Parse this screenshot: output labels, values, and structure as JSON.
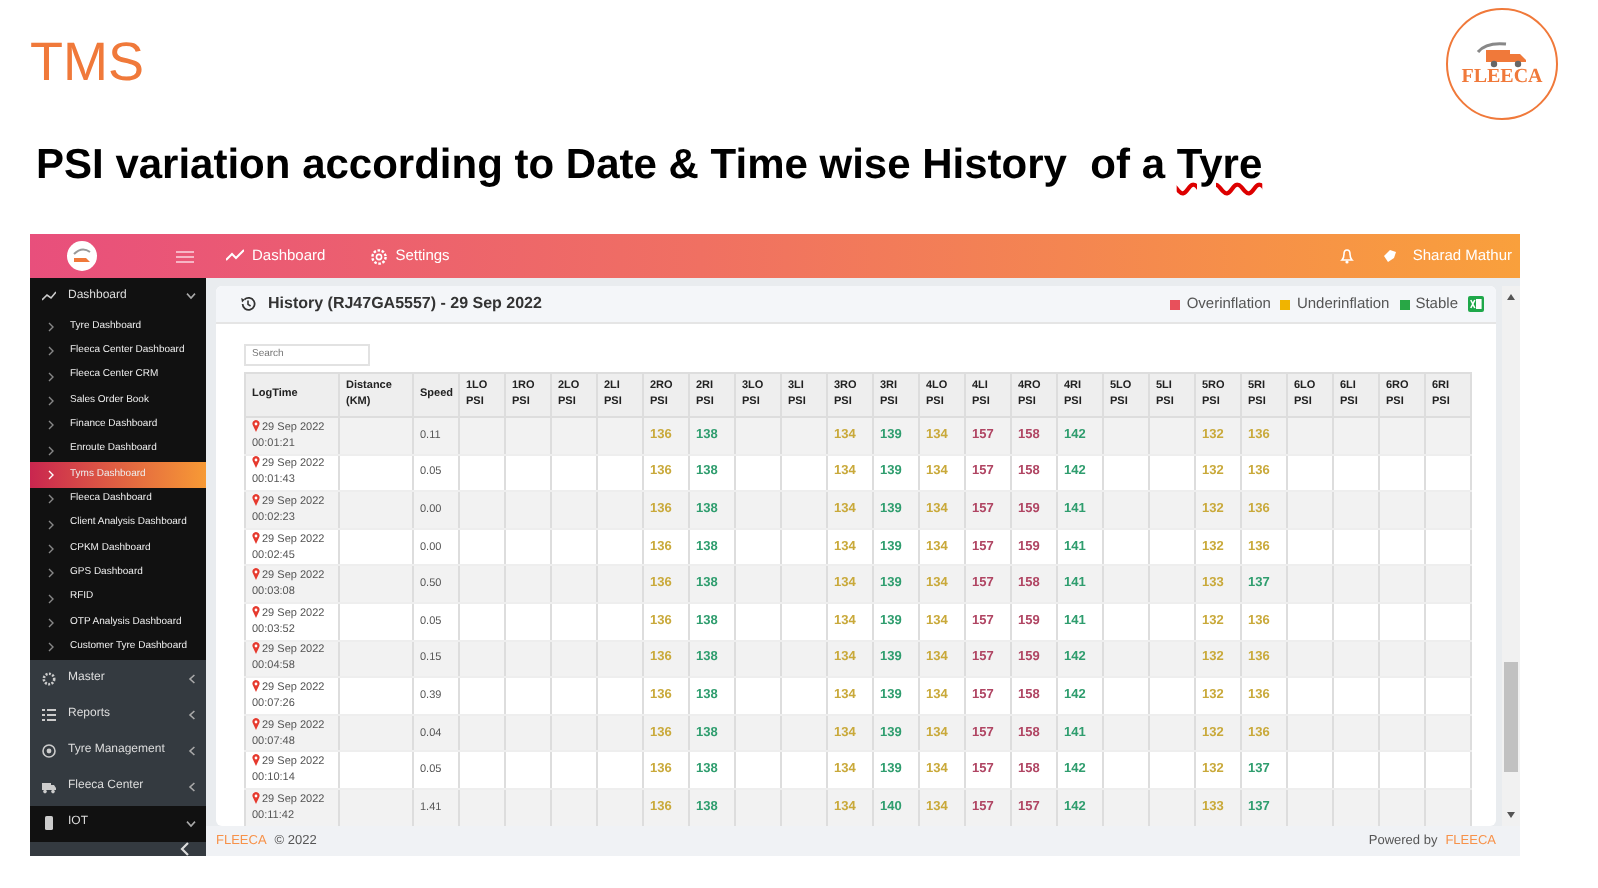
{
  "slide": {
    "title": "TMS",
    "heading": "PSI variation according to Date & Time wise History  of a Tyre",
    "logo_text": "FLEECA"
  },
  "topbar": {
    "nav": [
      {
        "label": "Dashboard"
      },
      {
        "label": "Settings"
      }
    ],
    "user": "Sharad Mathur"
  },
  "sidebar": {
    "items": [
      {
        "label": "Dashboard",
        "expanded": true,
        "children": [
          {
            "label": "Tyre Dashboard",
            "selected": false
          },
          {
            "label": "Fleeca Center Dashboard",
            "selected": false
          },
          {
            "label": "Fleeca Center CRM",
            "selected": false
          },
          {
            "label": "Sales Order Book",
            "selected": false
          },
          {
            "label": "Finance Dashboard",
            "selected": false
          },
          {
            "label": "Enroute Dashboard",
            "selected": false
          },
          {
            "label": "Tyms Dashboard",
            "selected": true
          },
          {
            "label": "Fleeca Dashboard",
            "selected": false
          },
          {
            "label": "Client Analysis Dashboard",
            "selected": false
          },
          {
            "label": "CPKM Dashboard",
            "selected": false
          },
          {
            "label": "GPS Dashboard",
            "selected": false
          },
          {
            "label": "RFID",
            "selected": false
          },
          {
            "label": "OTP Analysis Dashboard",
            "selected": false
          },
          {
            "label": "Customer Tyre Dashboard",
            "selected": false
          }
        ]
      },
      {
        "label": "Master",
        "expanded": false
      },
      {
        "label": "Reports",
        "expanded": false
      },
      {
        "label": "Tyre Management",
        "expanded": false
      },
      {
        "label": "Fleeca Center",
        "expanded": false
      },
      {
        "label": "IOT",
        "expanded": true
      }
    ]
  },
  "card": {
    "title": "History (RJ47GA5557) - 29 Sep 2022",
    "legend": [
      {
        "label": "Overinflation",
        "color": "#e8505b"
      },
      {
        "label": "Underinflation",
        "color": "#f0b400"
      },
      {
        "label": "Stable",
        "color": "#28a745"
      }
    ],
    "search": {
      "placeholder": "Search"
    },
    "table": {
      "columns": [
        "LogTime",
        "Distance (KM)",
        "Speed",
        "1LO PSI",
        "1RO PSI",
        "2LO PSI",
        "2LI PSI",
        "2RO PSI",
        "2RI PSI",
        "3LO PSI",
        "3LI PSI",
        "3RO PSI",
        "3RI PSI",
        "4LO PSI",
        "4LI PSI",
        "4RO PSI",
        "4RI PSI",
        "5LO PSI",
        "5LI PSI",
        "5RO PSI",
        "5RI PSI",
        "6LO PSI",
        "6LI PSI",
        "6RO PSI",
        "6RI PSI"
      ],
      "rows": [
        {
          "date": "29 Sep 2022",
          "time": "00:01:21",
          "speed": "0.11",
          "psi": {
            "2RO": {
              "value": "136",
              "color": "#c9a93a"
            },
            "2RI": {
              "value": "138",
              "color": "#2f9d6e"
            },
            "3RO": {
              "value": "134",
              "color": "#c9a93a"
            },
            "3RI": {
              "value": "139",
              "color": "#2f9d6e"
            },
            "4LO": {
              "value": "134",
              "color": "#c9a93a"
            },
            "4LI": {
              "value": "157",
              "color": "#b04563"
            },
            "4RO": {
              "value": "158",
              "color": "#b04563"
            },
            "4RI": {
              "value": "142",
              "color": "#2f9d6e"
            },
            "5RO": {
              "value": "132",
              "color": "#c9a93a"
            },
            "5RI": {
              "value": "136",
              "color": "#c9a93a"
            }
          }
        },
        {
          "date": "29 Sep 2022",
          "time": "00:01:43",
          "speed": "0.05",
          "psi": {
            "2RO": {
              "value": "136",
              "color": "#c9a93a"
            },
            "2RI": {
              "value": "138",
              "color": "#2f9d6e"
            },
            "3RO": {
              "value": "134",
              "color": "#c9a93a"
            },
            "3RI": {
              "value": "139",
              "color": "#2f9d6e"
            },
            "4LO": {
              "value": "134",
              "color": "#c9a93a"
            },
            "4LI": {
              "value": "157",
              "color": "#b04563"
            },
            "4RO": {
              "value": "158",
              "color": "#b04563"
            },
            "4RI": {
              "value": "142",
              "color": "#2f9d6e"
            },
            "5RO": {
              "value": "132",
              "color": "#c9a93a"
            },
            "5RI": {
              "value": "136",
              "color": "#c9a93a"
            }
          }
        },
        {
          "date": "29 Sep 2022",
          "time": "00:02:23",
          "speed": "0.00",
          "psi": {
            "2RO": {
              "value": "136",
              "color": "#c9a93a"
            },
            "2RI": {
              "value": "138",
              "color": "#2f9d6e"
            },
            "3RO": {
              "value": "134",
              "color": "#c9a93a"
            },
            "3RI": {
              "value": "139",
              "color": "#2f9d6e"
            },
            "4LO": {
              "value": "134",
              "color": "#c9a93a"
            },
            "4LI": {
              "value": "157",
              "color": "#b04563"
            },
            "4RO": {
              "value": "159",
              "color": "#b04563"
            },
            "4RI": {
              "value": "141",
              "color": "#2f9d6e"
            },
            "5RO": {
              "value": "132",
              "color": "#c9a93a"
            },
            "5RI": {
              "value": "136",
              "color": "#c9a93a"
            }
          }
        },
        {
          "date": "29 Sep 2022",
          "time": "00:02:45",
          "speed": "0.00",
          "psi": {
            "2RO": {
              "value": "136",
              "color": "#c9a93a"
            },
            "2RI": {
              "value": "138",
              "color": "#2f9d6e"
            },
            "3RO": {
              "value": "134",
              "color": "#c9a93a"
            },
            "3RI": {
              "value": "139",
              "color": "#2f9d6e"
            },
            "4LO": {
              "value": "134",
              "color": "#c9a93a"
            },
            "4LI": {
              "value": "157",
              "color": "#b04563"
            },
            "4RO": {
              "value": "159",
              "color": "#b04563"
            },
            "4RI": {
              "value": "141",
              "color": "#2f9d6e"
            },
            "5RO": {
              "value": "132",
              "color": "#c9a93a"
            },
            "5RI": {
              "value": "136",
              "color": "#c9a93a"
            }
          }
        },
        {
          "date": "29 Sep 2022",
          "time": "00:03:08",
          "speed": "0.50",
          "psi": {
            "2RO": {
              "value": "136",
              "color": "#c9a93a"
            },
            "2RI": {
              "value": "138",
              "color": "#2f9d6e"
            },
            "3RO": {
              "value": "134",
              "color": "#c9a93a"
            },
            "3RI": {
              "value": "139",
              "color": "#2f9d6e"
            },
            "4LO": {
              "value": "134",
              "color": "#c9a93a"
            },
            "4LI": {
              "value": "157",
              "color": "#b04563"
            },
            "4RO": {
              "value": "158",
              "color": "#b04563"
            },
            "4RI": {
              "value": "141",
              "color": "#2f9d6e"
            },
            "5RO": {
              "value": "133",
              "color": "#c9a93a"
            },
            "5RI": {
              "value": "137",
              "color": "#2f9d6e"
            }
          }
        },
        {
          "date": "29 Sep 2022",
          "time": "00:03:52",
          "speed": "0.05",
          "psi": {
            "2RO": {
              "value": "136",
              "color": "#c9a93a"
            },
            "2RI": {
              "value": "138",
              "color": "#2f9d6e"
            },
            "3RO": {
              "value": "134",
              "color": "#c9a93a"
            },
            "3RI": {
              "value": "139",
              "color": "#2f9d6e"
            },
            "4LO": {
              "value": "134",
              "color": "#c9a93a"
            },
            "4LI": {
              "value": "157",
              "color": "#b04563"
            },
            "4RO": {
              "value": "159",
              "color": "#b04563"
            },
            "4RI": {
              "value": "141",
              "color": "#2f9d6e"
            },
            "5RO": {
              "value": "132",
              "color": "#c9a93a"
            },
            "5RI": {
              "value": "136",
              "color": "#c9a93a"
            }
          }
        },
        {
          "date": "29 Sep 2022",
          "time": "00:04:58",
          "speed": "0.15",
          "psi": {
            "2RO": {
              "value": "136",
              "color": "#c9a93a"
            },
            "2RI": {
              "value": "138",
              "color": "#2f9d6e"
            },
            "3RO": {
              "value": "134",
              "color": "#c9a93a"
            },
            "3RI": {
              "value": "139",
              "color": "#2f9d6e"
            },
            "4LO": {
              "value": "134",
              "color": "#c9a93a"
            },
            "4LI": {
              "value": "157",
              "color": "#b04563"
            },
            "4RO": {
              "value": "159",
              "color": "#b04563"
            },
            "4RI": {
              "value": "142",
              "color": "#2f9d6e"
            },
            "5RO": {
              "value": "132",
              "color": "#c9a93a"
            },
            "5RI": {
              "value": "136",
              "color": "#c9a93a"
            }
          }
        },
        {
          "date": "29 Sep 2022",
          "time": "00:07:26",
          "speed": "0.39",
          "psi": {
            "2RO": {
              "value": "136",
              "color": "#c9a93a"
            },
            "2RI": {
              "value": "138",
              "color": "#2f9d6e"
            },
            "3RO": {
              "value": "134",
              "color": "#c9a93a"
            },
            "3RI": {
              "value": "139",
              "color": "#2f9d6e"
            },
            "4LO": {
              "value": "134",
              "color": "#c9a93a"
            },
            "4LI": {
              "value": "157",
              "color": "#b04563"
            },
            "4RO": {
              "value": "158",
              "color": "#b04563"
            },
            "4RI": {
              "value": "142",
              "color": "#2f9d6e"
            },
            "5RO": {
              "value": "132",
              "color": "#c9a93a"
            },
            "5RI": {
              "value": "136",
              "color": "#c9a93a"
            }
          }
        },
        {
          "date": "29 Sep 2022",
          "time": "00:07:48",
          "speed": "0.04",
          "psi": {
            "2RO": {
              "value": "136",
              "color": "#c9a93a"
            },
            "2RI": {
              "value": "138",
              "color": "#2f9d6e"
            },
            "3RO": {
              "value": "134",
              "color": "#c9a93a"
            },
            "3RI": {
              "value": "139",
              "color": "#2f9d6e"
            },
            "4LO": {
              "value": "134",
              "color": "#c9a93a"
            },
            "4LI": {
              "value": "157",
              "color": "#b04563"
            },
            "4RO": {
              "value": "158",
              "color": "#b04563"
            },
            "4RI": {
              "value": "141",
              "color": "#2f9d6e"
            },
            "5RO": {
              "value": "132",
              "color": "#c9a93a"
            },
            "5RI": {
              "value": "136",
              "color": "#c9a93a"
            }
          }
        },
        {
          "date": "29 Sep 2022",
          "time": "00:10:14",
          "speed": "0.05",
          "psi": {
            "2RO": {
              "value": "136",
              "color": "#c9a93a"
            },
            "2RI": {
              "value": "138",
              "color": "#2f9d6e"
            },
            "3RO": {
              "value": "134",
              "color": "#c9a93a"
            },
            "3RI": {
              "value": "139",
              "color": "#2f9d6e"
            },
            "4LO": {
              "value": "134",
              "color": "#c9a93a"
            },
            "4LI": {
              "value": "157",
              "color": "#b04563"
            },
            "4RO": {
              "value": "158",
              "color": "#b04563"
            },
            "4RI": {
              "value": "142",
              "color": "#2f9d6e"
            },
            "5RO": {
              "value": "132",
              "color": "#c9a93a"
            },
            "5RI": {
              "value": "137",
              "color": "#2f9d6e"
            }
          }
        },
        {
          "date": "29 Sep 2022",
          "time": "00:11:42",
          "speed": "1.41",
          "psi": {
            "2RO": {
              "value": "136",
              "color": "#c9a93a"
            },
            "2RI": {
              "value": "138",
              "color": "#2f9d6e"
            },
            "3RO": {
              "value": "134",
              "color": "#c9a93a"
            },
            "3RI": {
              "value": "140",
              "color": "#2f9d6e"
            },
            "4LO": {
              "value": "134",
              "color": "#c9a93a"
            },
            "4LI": {
              "value": "157",
              "color": "#b04563"
            },
            "4RO": {
              "value": "157",
              "color": "#b04563"
            },
            "4RI": {
              "value": "142",
              "color": "#2f9d6e"
            },
            "5RO": {
              "value": "133",
              "color": "#c9a93a"
            },
            "5RI": {
              "value": "137",
              "color": "#2f9d6e"
            }
          }
        }
      ]
    }
  },
  "footer": {
    "brand": "FLEECA",
    "copyright": "© 2022",
    "powered_by": "Powered by",
    "powered_brand": "FLEECA"
  }
}
